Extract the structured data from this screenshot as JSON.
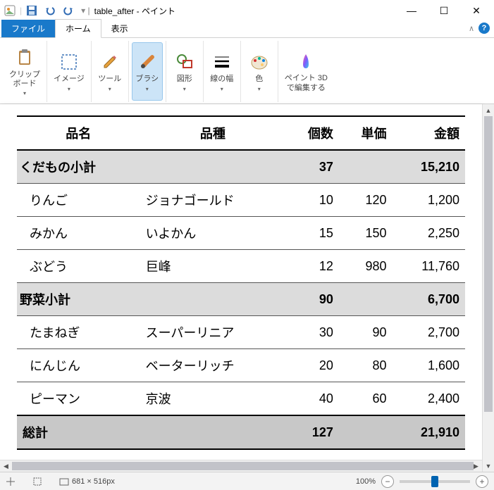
{
  "title": {
    "doc": "table_after",
    "app": "ペイント"
  },
  "tabs": {
    "file": "ファイル",
    "home": "ホーム",
    "view": "表示"
  },
  "ribbon": {
    "clipboard": "クリップ\nボード",
    "image": "イメージ",
    "tools": "ツール",
    "brushes": "ブラシ",
    "shapes": "図形",
    "stroke": "線の幅",
    "color": "色",
    "paint3d": "ペイント 3D\nで編集する"
  },
  "chart_data": {
    "type": "table",
    "columns": [
      "品名",
      "品種",
      "個数",
      "単価",
      "金額"
    ],
    "rows": [
      {
        "kind": "sub",
        "name": "くだもの小計",
        "variety": "",
        "qty": "37",
        "unit": "",
        "amount": "15,210"
      },
      {
        "kind": "item",
        "name": "りんご",
        "variety": "ジョナゴールド",
        "qty": "10",
        "unit": "120",
        "amount": "1,200"
      },
      {
        "kind": "item",
        "name": "みかん",
        "variety": "いよかん",
        "qty": "15",
        "unit": "150",
        "amount": "2,250"
      },
      {
        "kind": "item",
        "name": "ぶどう",
        "variety": "巨峰",
        "qty": "12",
        "unit": "980",
        "amount": "11,760"
      },
      {
        "kind": "sub",
        "name": "野菜小計",
        "variety": "",
        "qty": "90",
        "unit": "",
        "amount": "6,700"
      },
      {
        "kind": "item",
        "name": "たまねぎ",
        "variety": "スーパーリニア",
        "qty": "30",
        "unit": "90",
        "amount": "2,700"
      },
      {
        "kind": "item",
        "name": "にんじん",
        "variety": "ベーターリッチ",
        "qty": "20",
        "unit": "80",
        "amount": "1,600"
      },
      {
        "kind": "item",
        "name": "ピーマン",
        "variety": "京波",
        "qty": "40",
        "unit": "60",
        "amount": "2,400"
      },
      {
        "kind": "total",
        "name": "総計",
        "variety": "",
        "qty": "127",
        "unit": "",
        "amount": "21,910"
      }
    ]
  },
  "status": {
    "dims": "681 × 516px",
    "zoom": "100%"
  }
}
